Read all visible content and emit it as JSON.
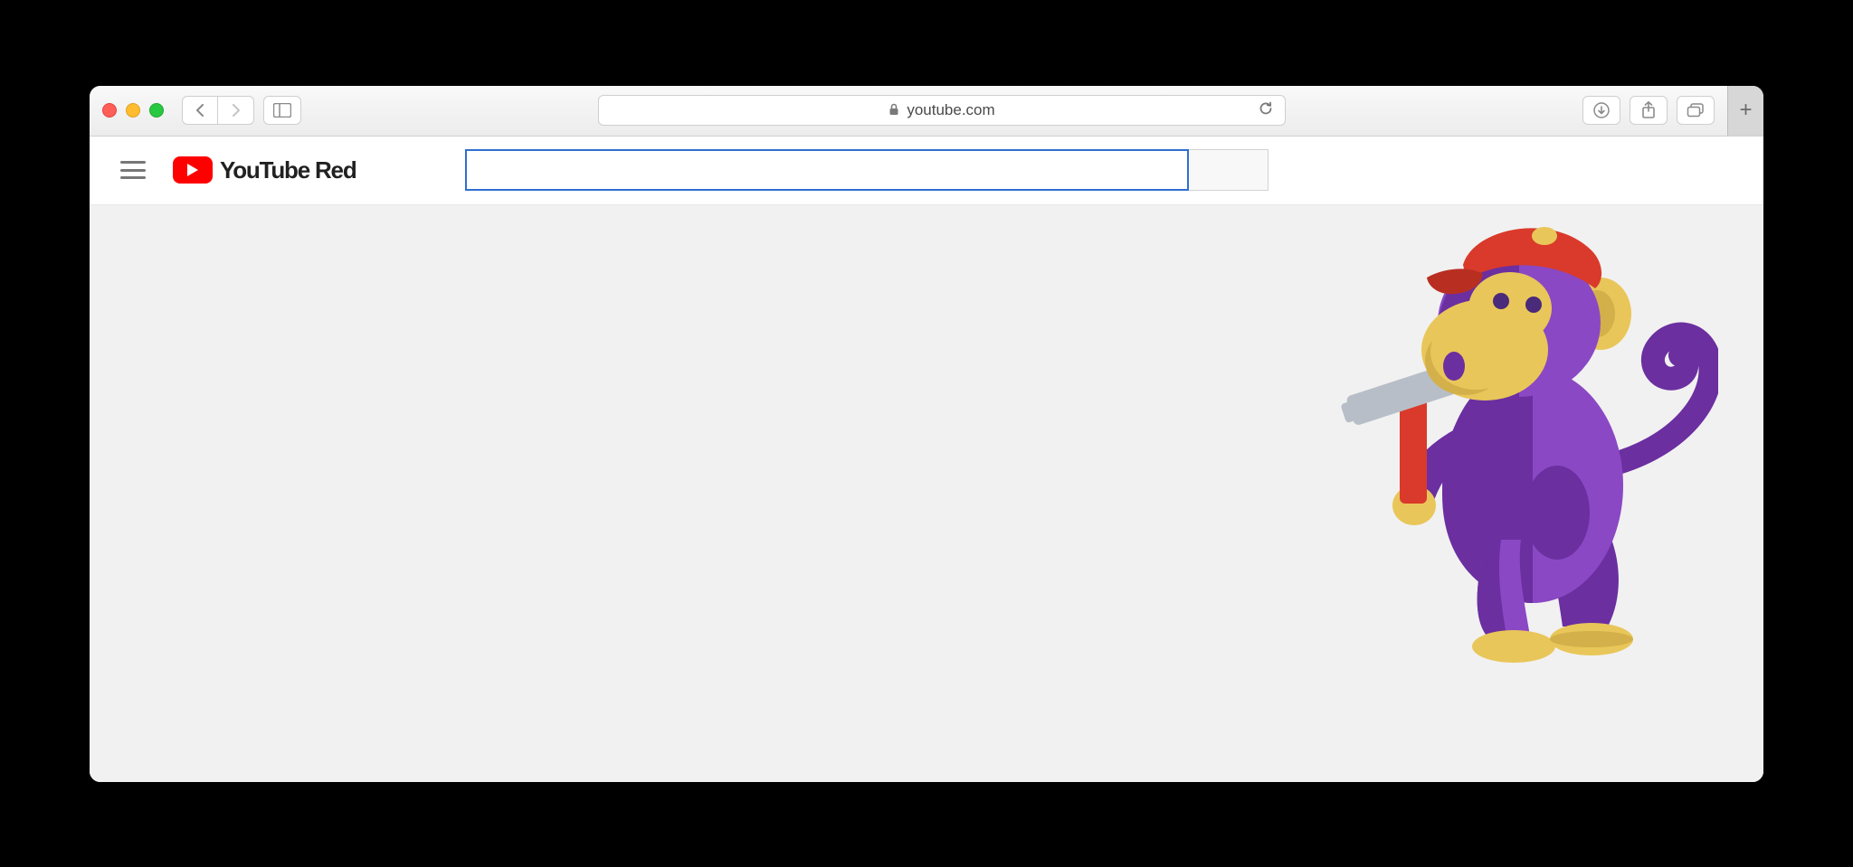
{
  "browser": {
    "url": "youtube.com"
  },
  "logo": {
    "brand": "YouTube",
    "suffix": "Red"
  },
  "search": {
    "value": "",
    "placeholder": ""
  },
  "illustration": {
    "name": "error-monkey",
    "colors": {
      "body": "#6b2fa0",
      "body_light": "#8a48c4",
      "skin": "#e9c659",
      "skin_dark": "#d4b04a",
      "cap": "#d93a2b",
      "hammer_handle": "#d93a2b",
      "hammer_head": "#b8bec7"
    }
  }
}
